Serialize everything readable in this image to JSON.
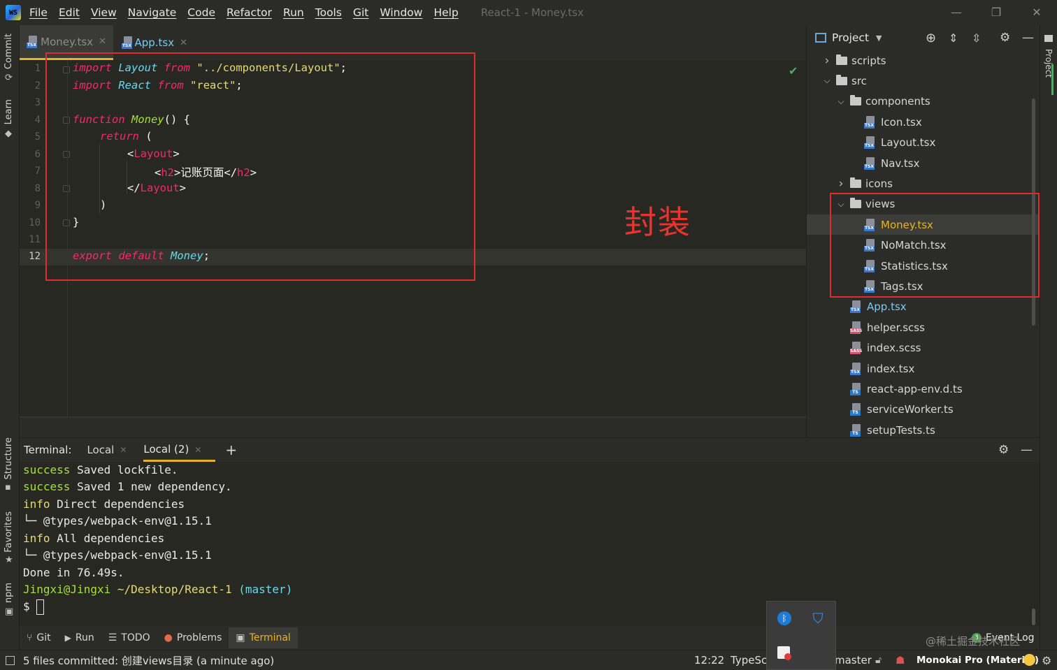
{
  "app": {
    "logo_text": "WS",
    "window_title": "React-1 - Money.tsx"
  },
  "menu": [
    "File",
    "Edit",
    "View",
    "Navigate",
    "Code",
    "Refactor",
    "Run",
    "Tools",
    "Git",
    "Window",
    "Help"
  ],
  "window_buttons": {
    "minimize": "—",
    "restore": "❐",
    "close": "✕"
  },
  "left_strip": [
    "Commit",
    "Learn",
    "Structure",
    "Favorites",
    "npm"
  ],
  "editor_tabs": [
    {
      "label": "Money.tsx",
      "active": true
    },
    {
      "label": "App.tsx",
      "active": false
    }
  ],
  "editor": {
    "line_numbers": [
      "1",
      "2",
      "3",
      "4",
      "5",
      "6",
      "7",
      "8",
      "9",
      "10",
      "11",
      "12"
    ],
    "current_line": "12",
    "lines": {
      "l1": {
        "kw1": "import",
        "name": "Layout",
        "kw2": "from",
        "str": "\"../components/Layout\"",
        "end": ";"
      },
      "l2": {
        "kw1": "import",
        "name": "React",
        "kw2": "from",
        "str": "\"react\"",
        "end": ";"
      },
      "l4": {
        "kw": "function",
        "name": "Money",
        "rest": "() {"
      },
      "l5": {
        "kw": "return",
        "rest": " ("
      },
      "l6": {
        "open": "<",
        "tag": "Layout",
        "close": ">"
      },
      "l7": {
        "open": "<",
        "tag": "h2",
        "close": ">",
        "text": "记账页面",
        "open2": "</",
        "tag2": "h2",
        "close2": ">"
      },
      "l8": {
        "open": "</",
        "tag": "Layout",
        "close": ">"
      },
      "l9": ")",
      "l10": "}",
      "l12": {
        "kw1": "export",
        "kw2": "default",
        "name": "Money",
        "end": ";"
      }
    },
    "annotation": "封装",
    "inspection_status": "✔"
  },
  "project_panel": {
    "title": "Project",
    "side_label": "Project",
    "tree": [
      {
        "label": "scripts",
        "type": "folder",
        "state": "collapsed",
        "depth": 1
      },
      {
        "label": "src",
        "type": "folder",
        "state": "expanded",
        "depth": 1
      },
      {
        "label": "components",
        "type": "folder",
        "state": "expanded",
        "depth": 2
      },
      {
        "label": "Icon.tsx",
        "type": "tsx",
        "depth": 3
      },
      {
        "label": "Layout.tsx",
        "type": "tsx",
        "depth": 3
      },
      {
        "label": "Nav.tsx",
        "type": "tsx",
        "depth": 3
      },
      {
        "label": "icons",
        "type": "folder",
        "state": "collapsed",
        "depth": 2
      },
      {
        "label": "views",
        "type": "folder",
        "state": "expanded",
        "depth": 2
      },
      {
        "label": "Money.tsx",
        "type": "tsx",
        "depth": 3,
        "selected": true
      },
      {
        "label": "NoMatch.tsx",
        "type": "tsx",
        "depth": 3
      },
      {
        "label": "Statistics.tsx",
        "type": "tsx",
        "depth": 3
      },
      {
        "label": "Tags.tsx",
        "type": "tsx",
        "depth": 3
      },
      {
        "label": "App.tsx",
        "type": "tsx",
        "depth": 2,
        "modified": true
      },
      {
        "label": "helper.scss",
        "type": "sass",
        "depth": 2
      },
      {
        "label": "index.scss",
        "type": "sass",
        "depth": 2
      },
      {
        "label": "index.tsx",
        "type": "tsx",
        "depth": 2
      },
      {
        "label": "react-app-env.d.ts",
        "type": "ts",
        "depth": 2
      },
      {
        "label": "serviceWorker.ts",
        "type": "ts",
        "depth": 2
      },
      {
        "label": "setupTests.ts",
        "type": "ts",
        "depth": 2
      }
    ]
  },
  "terminal": {
    "label": "Terminal:",
    "tabs": [
      {
        "label": "Local",
        "active": false
      },
      {
        "label": "Local (2)",
        "active": true
      }
    ],
    "add": "+",
    "lines": [
      {
        "prefix": "success",
        "text": " Saved lockfile."
      },
      {
        "prefix": "success",
        "text": " Saved 1 new dependency."
      },
      {
        "prefix": "info",
        "text": " Direct dependencies"
      },
      {
        "prefix": "",
        "text": "└─ @types/webpack-env@1.15.1"
      },
      {
        "prefix": "info",
        "text": " All dependencies"
      },
      {
        "prefix": "",
        "text": "└─ @types/webpack-env@1.15.1"
      },
      {
        "prefix": "",
        "text": "Done in 76.49s."
      }
    ],
    "prompt": {
      "user": "Jingxi@Jingxi",
      "path": " ~/Desktop/React-1",
      "branch": " (master)",
      "symbol": "$"
    }
  },
  "bottom_toolbar": [
    {
      "label": "Git",
      "icon": "git-branch-icon"
    },
    {
      "label": "Run",
      "icon": "play-icon"
    },
    {
      "label": "TODO",
      "icon": "list-icon"
    },
    {
      "label": "Problems",
      "icon": "warning-icon"
    },
    {
      "label": "Terminal",
      "icon": "terminal-icon",
      "active": true
    }
  ],
  "event_log": {
    "count": "3",
    "label": "Event Log"
  },
  "status_bar": {
    "message": "5 files committed: 创建views目录 (a minute ago)",
    "position": "12:22",
    "language": "TypeSc",
    "branch": "master",
    "theme": "Monokai Pro (Material)",
    "watermark": "@稀土掘金技术社区"
  },
  "colors": {
    "accent": "#e6b422",
    "annotation": "#e02c2c",
    "selected_row": "#3c3d39"
  }
}
